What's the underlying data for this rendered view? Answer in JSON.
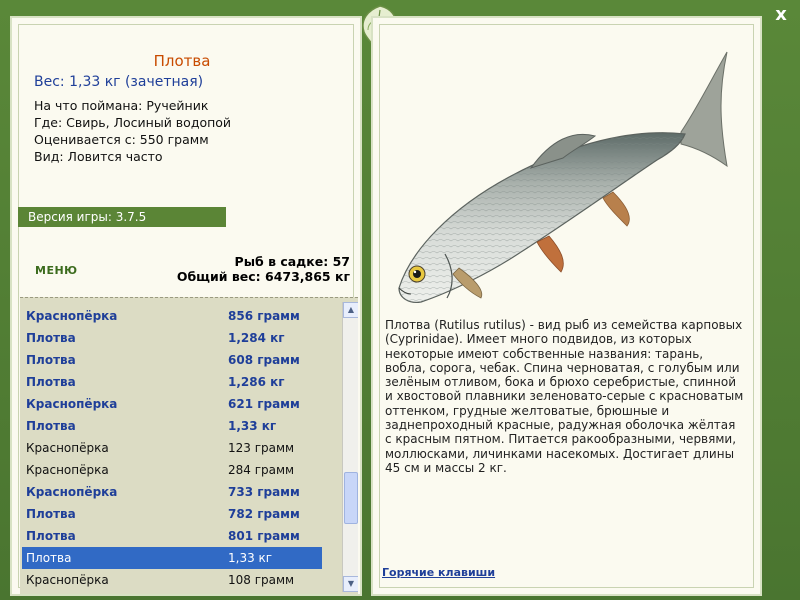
{
  "window": {
    "close_glyph": "x",
    "emblem_icon": "leaf-emblem-icon"
  },
  "catch": {
    "title": "Плотва",
    "weight": "Вес: 1,33 кг (зачетная)",
    "info": [
      {
        "label": "На что поймана:",
        "value": "Ручейник"
      },
      {
        "label": "Где:",
        "value": "Свирь, Лосиный водопой"
      },
      {
        "label": "Оценивается с:",
        "value": "550 грамм"
      },
      {
        "label": "Вид:",
        "value": "Ловится часто"
      }
    ]
  },
  "version": "Версия игры: 3.7.5",
  "menu_label": "МЕНЮ",
  "stats": {
    "fish_in_keepnet": "Рыб в садке: 57",
    "total_weight": "Общий вес: 6473,865 кг"
  },
  "list": [
    {
      "name": "Краснопёрка",
      "weight": "856 грамм",
      "bold": true,
      "selected": false
    },
    {
      "name": "Плотва",
      "weight": "1,284 кг",
      "bold": true,
      "selected": false
    },
    {
      "name": "Плотва",
      "weight": "608 грамм",
      "bold": true,
      "selected": false
    },
    {
      "name": "Плотва",
      "weight": "1,286 кг",
      "bold": true,
      "selected": false
    },
    {
      "name": "Краснопёрка",
      "weight": "621 грамм",
      "bold": true,
      "selected": false
    },
    {
      "name": "Плотва",
      "weight": "1,33 кг",
      "bold": true,
      "selected": false
    },
    {
      "name": "Краснопёрка",
      "weight": "123 грамм",
      "bold": false,
      "selected": false
    },
    {
      "name": "Краснопёрка",
      "weight": "284 грамм",
      "bold": false,
      "selected": false
    },
    {
      "name": "Краснопёрка",
      "weight": "733 грамм",
      "bold": true,
      "selected": false
    },
    {
      "name": "Плотва",
      "weight": "782 грамм",
      "bold": true,
      "selected": false
    },
    {
      "name": "Плотва",
      "weight": "801 грамм",
      "bold": true,
      "selected": false
    },
    {
      "name": "Плотва",
      "weight": "1,33 кг",
      "bold": false,
      "selected": true
    },
    {
      "name": "Краснопёрка",
      "weight": "108 грамм",
      "bold": false,
      "selected": false
    }
  ],
  "description": "Плотва (Rutilus rutilus) - вид рыб из семейства карповых (Cyprinidae). Имеет много подвидов, из которых некоторые имеют собственные названия: тарань, вобла, сорога, чебак. Спина черноватая, с голубым или зелёным отливом, бока и брюхо серебристые, спинной и хвостовой плавники зеленовато-серые с красноватым оттенком, грудные желтоватые, брюшные и заднепроходный красные, радужная оболочка жёлтая с красным пятном. Питается ракообразными, червями, моллюсками, личинками насекомых. Достигает длины 45 см и массы 2 кг.",
  "hotkeys_label": "Горячие клавиши",
  "colors": {
    "frame_green": "#4e7a30",
    "panel_bg": "#fbfaf0",
    "title_orange": "#c84b00",
    "text_blue": "#1f3f99",
    "selection_blue": "#316ac5",
    "list_bg": "#dcdcc4"
  }
}
